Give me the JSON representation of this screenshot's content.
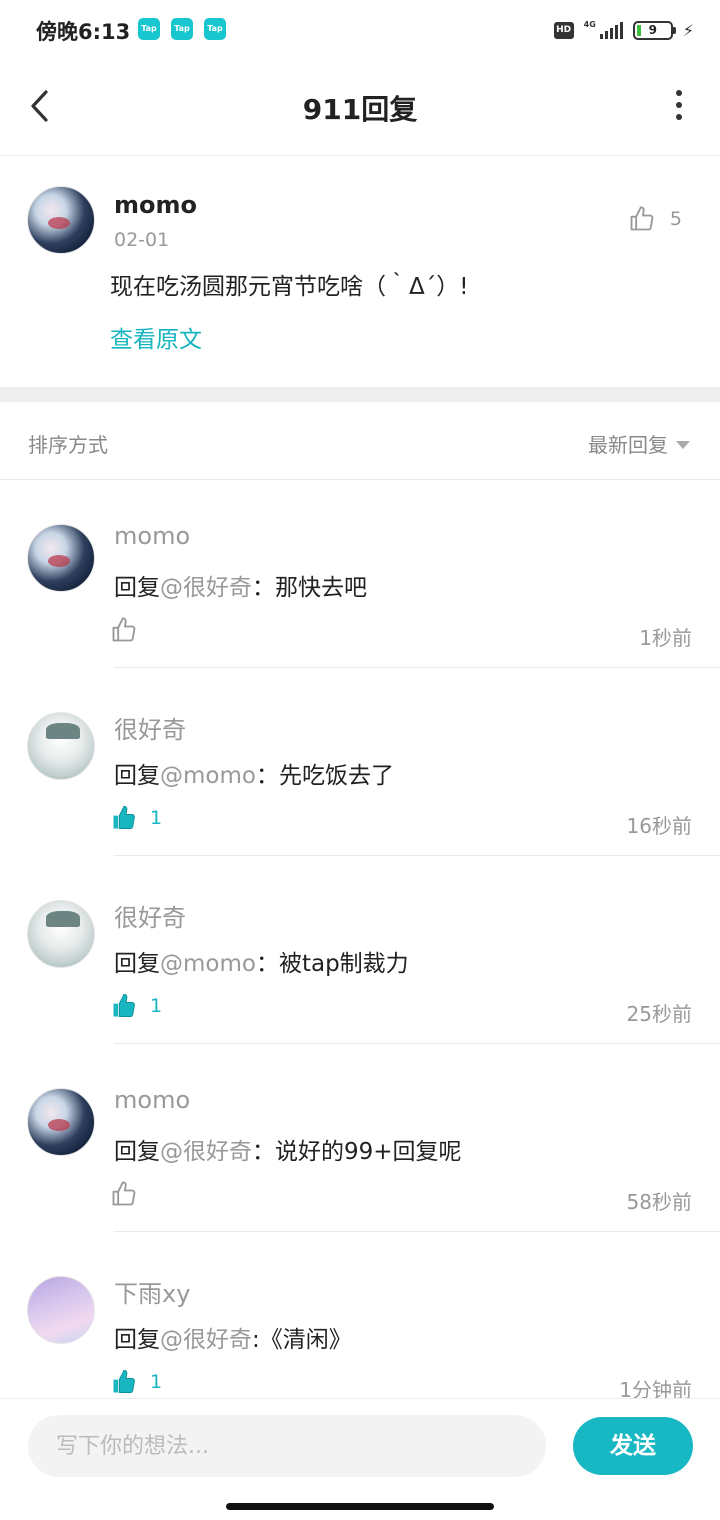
{
  "status_bar": {
    "time": "傍晚6:13",
    "app_badge": "Tap",
    "hd": "HD",
    "network": "4G",
    "battery": "9"
  },
  "header": {
    "title": "911回复",
    "back_icon": "chevron-left-icon",
    "more_icon": "more-vertical-icon"
  },
  "post": {
    "author": "momo",
    "date": "02-01",
    "text": "现在吃汤圆那元宵节吃啥（｀Δ´）!",
    "view_original": "查看原文",
    "like_count": "5"
  },
  "sort": {
    "label": "排序方式",
    "selected": "最新回复"
  },
  "reply_prefix": "回复",
  "replies": [
    {
      "name": "momo",
      "mention": "@很好奇",
      "text": "：那快去吧",
      "liked": false,
      "likes": "",
      "time": "1秒前"
    },
    {
      "name": "很好奇",
      "mention": "@momo",
      "text": "：先吃饭去了",
      "liked": true,
      "likes": "1",
      "time": "16秒前"
    },
    {
      "name": "很好奇",
      "mention": "@momo",
      "text": "：被tap制裁力",
      "liked": true,
      "likes": "1",
      "time": "25秒前"
    },
    {
      "name": "momo",
      "mention": "@很好奇",
      "text": "：说好的99+回复呢",
      "liked": false,
      "likes": "",
      "time": "58秒前"
    },
    {
      "name": "下雨xy",
      "mention": "@很好奇",
      "text": ":《清闲》",
      "liked": true,
      "likes": "1",
      "time": "1分钟前"
    }
  ],
  "composer": {
    "placeholder": "写下你的想法...",
    "value": "",
    "send_label": "发送"
  },
  "colors": {
    "accent": "#17b8c4",
    "muted_text": "#999999",
    "separator_band": "#eeeeee"
  }
}
